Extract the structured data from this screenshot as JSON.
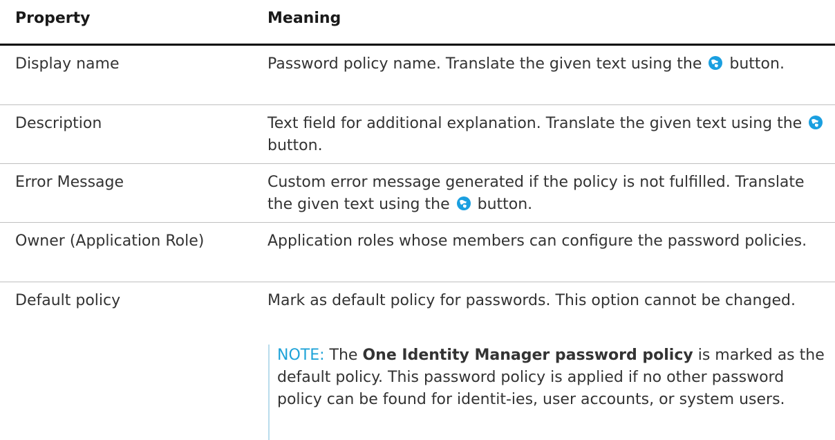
{
  "table": {
    "headers": {
      "property": "Property",
      "meaning": "Meaning"
    },
    "rows": [
      {
        "property": "Display name",
        "meaning_before": "Password policy name. Translate the given text using the",
        "meaning_after": "button."
      },
      {
        "property": "Description",
        "meaning_before": "Text field for additional explanation. Translate the given text using the",
        "meaning_after": "button."
      },
      {
        "property": "Error Message",
        "meaning_before": "Custom error message generated if the policy is not fulfilled. Translate the given text using the",
        "meaning_after": "button."
      },
      {
        "property": "Owner (Application Role)",
        "meaning": "Application roles whose members can configure the password policies."
      },
      {
        "property": "Default policy",
        "meaning": "Mark as default policy for passwords. This option cannot be changed.",
        "note": {
          "label": "NOTE:",
          "text_1": "The",
          "bold": "One Identity Manager password policy",
          "text_2": "is marked as the default policy. This password policy is applied if no other password policy can be found for identit-ies, user accounts, or system users."
        }
      }
    ]
  },
  "icons": {
    "translate": "globe-translate-icon"
  },
  "colors": {
    "note_label": "#1fa3d8",
    "note_bar": "#b9dcec",
    "header_rule": "#000000",
    "row_rule": "#bfbfbf",
    "globe": "#1a9fe0"
  }
}
